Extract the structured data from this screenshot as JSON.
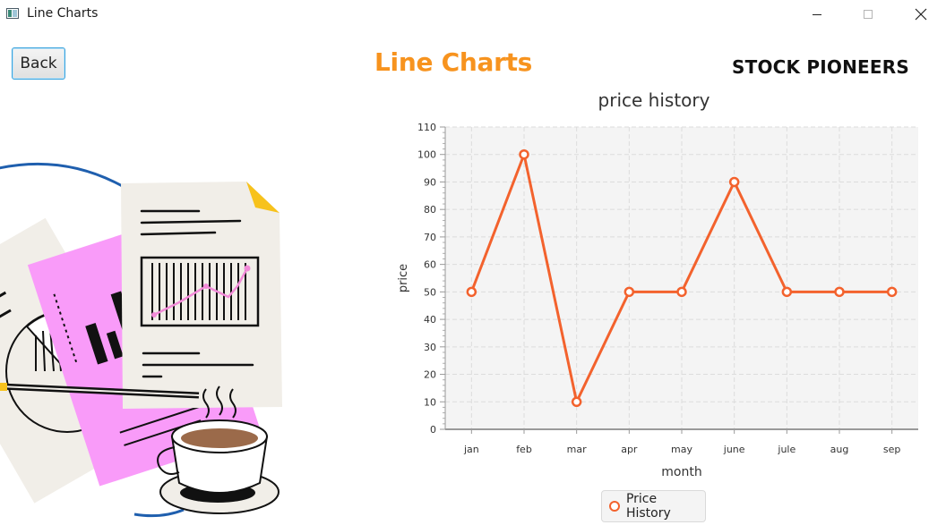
{
  "window": {
    "title": "Line Charts"
  },
  "header": {
    "back_label": "Back",
    "page_title": "Line Charts",
    "brand": "STOCK PIONEERS"
  },
  "colors": {
    "title_accent": "#f7931e",
    "series_line": "#f3622d",
    "plot_background": "#f4f4f4"
  },
  "chart_data": {
    "type": "line",
    "title": "price history",
    "xlabel": "month",
    "ylabel": "price",
    "categories": [
      "jan",
      "feb",
      "mar",
      "apr",
      "may",
      "june",
      "jule",
      "aug",
      "sep"
    ],
    "series": [
      {
        "name": "Price History",
        "values": [
          50,
          100,
          10,
          50,
          50,
          90,
          50,
          50,
          50
        ]
      }
    ],
    "ylim": [
      0,
      110
    ],
    "yticks": [
      0,
      10,
      20,
      30,
      40,
      50,
      60,
      70,
      80,
      90,
      100,
      110
    ],
    "grid": true,
    "legend": "bottom-center"
  }
}
